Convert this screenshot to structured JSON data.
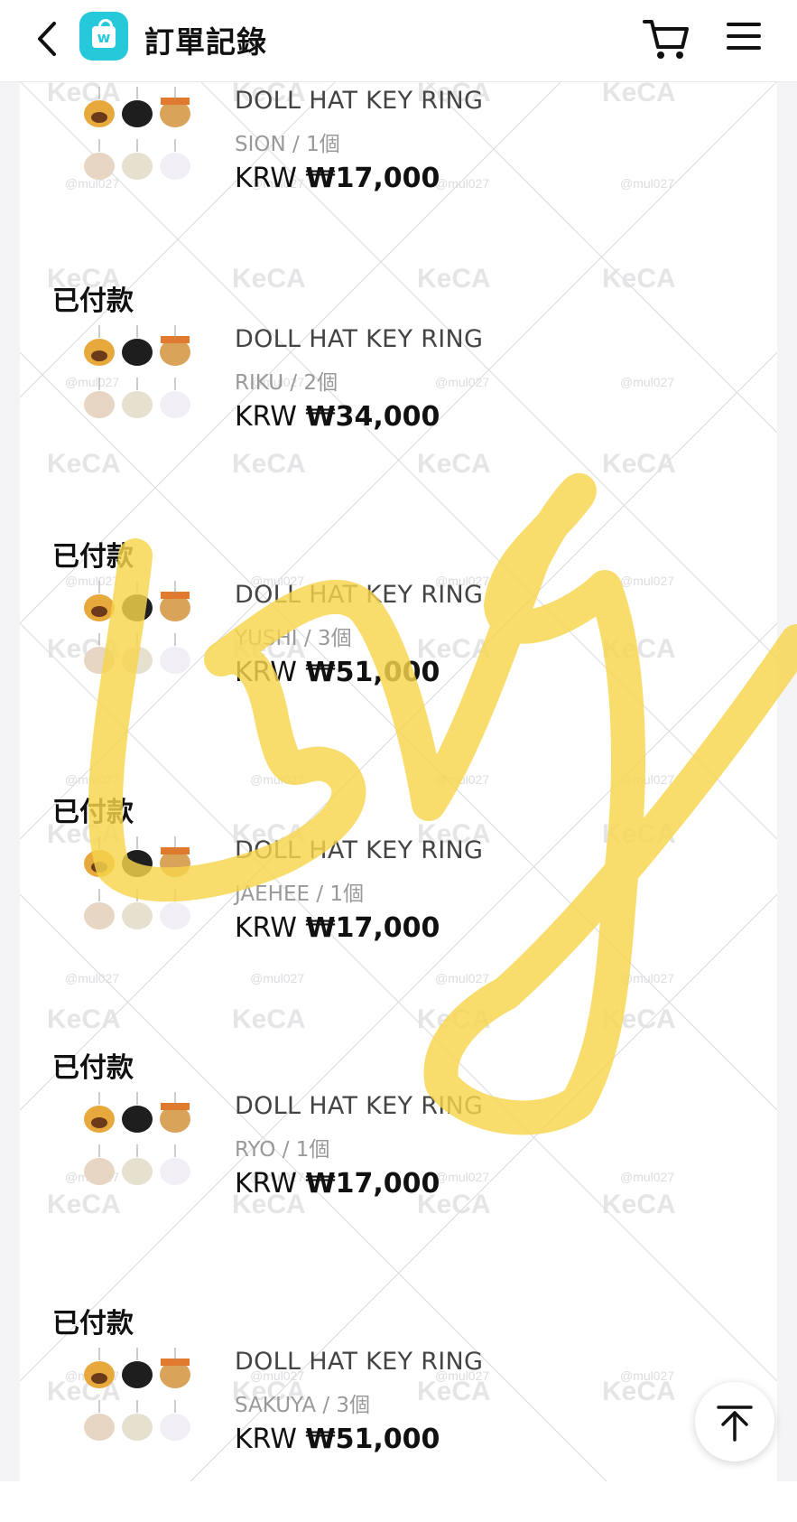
{
  "header": {
    "title": "訂單記錄",
    "logo_letter": "w",
    "logo_color": "#25c9d9"
  },
  "icons": [
    "back-icon",
    "shop-bag-icon",
    "cart-icon",
    "menu-icon",
    "arrow-up-icon"
  ],
  "watermark": {
    "brand": "KeCA",
    "handle": "@mul027"
  },
  "orders": [
    {
      "status": "",
      "name": "DOLL HAT KEY RING",
      "meta": "SION / 1個",
      "currency": "KRW",
      "price": "₩17,000"
    },
    {
      "status": "已付款",
      "name": "DOLL HAT KEY RING",
      "meta": "RIKU / 2個",
      "currency": "KRW",
      "price": "₩34,000"
    },
    {
      "status": "已付款",
      "name": "DOLL HAT KEY RING",
      "meta": "YUSHI / 3個",
      "currency": "KRW",
      "price": "₩51,000"
    },
    {
      "status": "已付款",
      "name": "DOLL HAT KEY RING",
      "meta": "JAEHEE / 1個",
      "currency": "KRW",
      "price": "₩17,000"
    },
    {
      "status": "已付款",
      "name": "DOLL HAT KEY RING",
      "meta": "RYO / 1個",
      "currency": "KRW",
      "price": "₩17,000"
    },
    {
      "status": "已付款",
      "name": "DOLL HAT KEY RING",
      "meta": "SAKUYA / 3個",
      "currency": "KRW",
      "price": "₩51,000"
    }
  ],
  "scribble_color": "#f7d44c"
}
